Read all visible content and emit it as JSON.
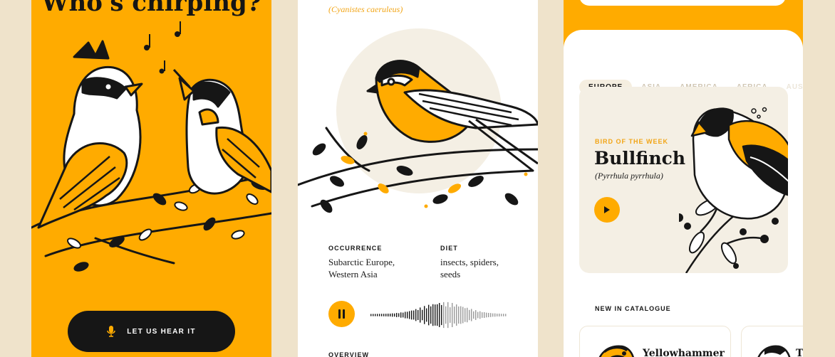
{
  "screen1": {
    "title": "Who's chirping?",
    "cta_label": "LET US HEAR IT",
    "icons": [
      "mic-icon",
      "music-note-icon"
    ]
  },
  "screen2": {
    "scientific_name": "(Cyanistes caeruleus)",
    "occurrence": {
      "label": "OCCURRENCE",
      "value": "Subarctic Europe, Western Asia"
    },
    "diet": {
      "label": "DIET",
      "value": "insects, spiders, seeds"
    },
    "overview_label": "OVERVIEW",
    "icons": [
      "pause-icon",
      "waveform-icon"
    ]
  },
  "screen3": {
    "regions": [
      "EUROPE",
      "ASIA",
      "AMERICA",
      "AFRICA",
      "AUST"
    ],
    "active_region": "EUROPE",
    "bird_of_week": {
      "kicker": "BIRD OF THE WEEK",
      "name": "Bullfinch",
      "scientific": "(Pyrrhula pyrrhula)"
    },
    "catalogue_title": "NEW IN CATALOGUE",
    "catalogue": [
      {
        "name": "Yellowhammer"
      },
      {
        "name": "T"
      }
    ],
    "icons": [
      "play-icon"
    ]
  },
  "colors": {
    "accent": "#FFAB00",
    "ink": "#161616",
    "background": "#EFE3CB",
    "card": "#F4EFE4"
  }
}
